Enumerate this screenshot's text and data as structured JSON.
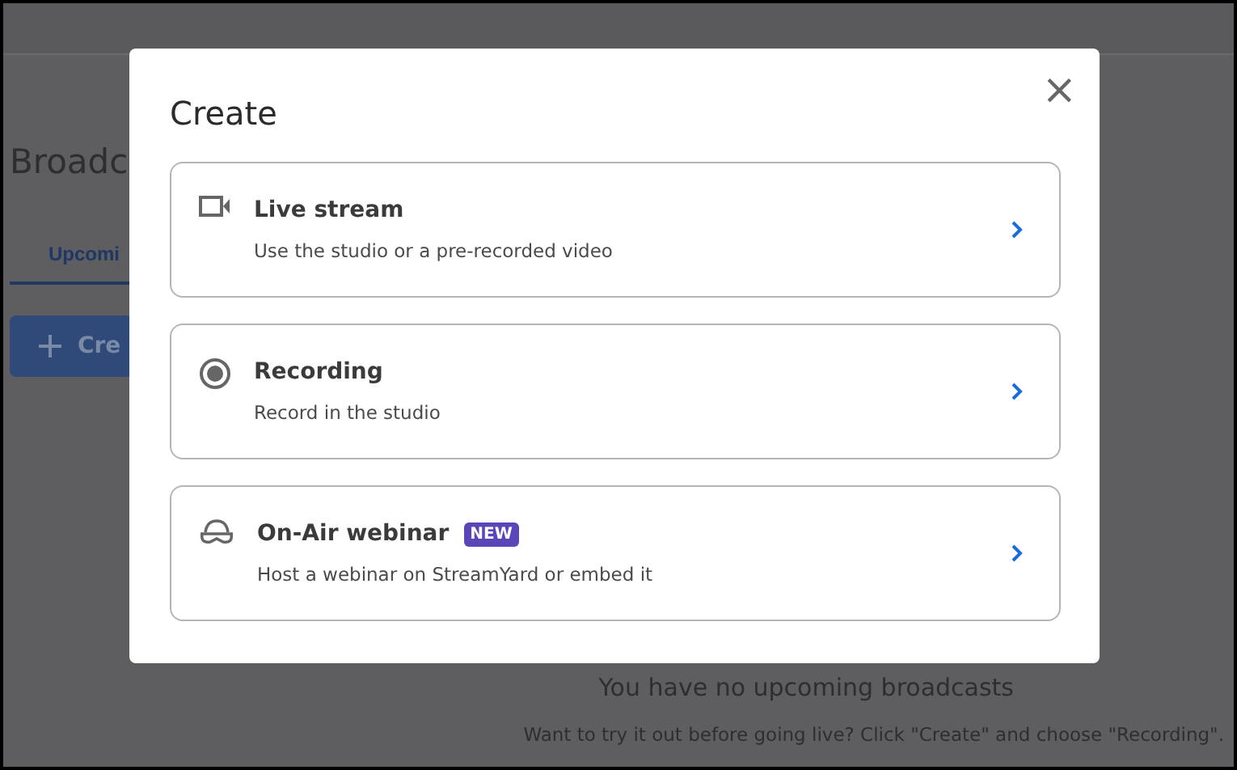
{
  "page": {
    "heading": "Broadc",
    "tabs": [
      {
        "label": "Upcomi",
        "selected": true
      }
    ],
    "create_button": "Cre",
    "empty_title": "You have no upcoming broadcasts",
    "empty_hint": "Want to try it out before going live? Click \"Create\" and choose \"Recording\"."
  },
  "dialog": {
    "title": "Create",
    "close": "×",
    "options": [
      {
        "kind": "camera",
        "title": "Live stream",
        "description": "Use the studio or a pre-recorded video"
      },
      {
        "kind": "record",
        "title": "Recording",
        "description": "Record in the studio"
      },
      {
        "kind": "webinar",
        "title": "On-Air webinar",
        "badge": "NEW",
        "description": "Host a webinar on StreamYard or embed it"
      }
    ]
  }
}
